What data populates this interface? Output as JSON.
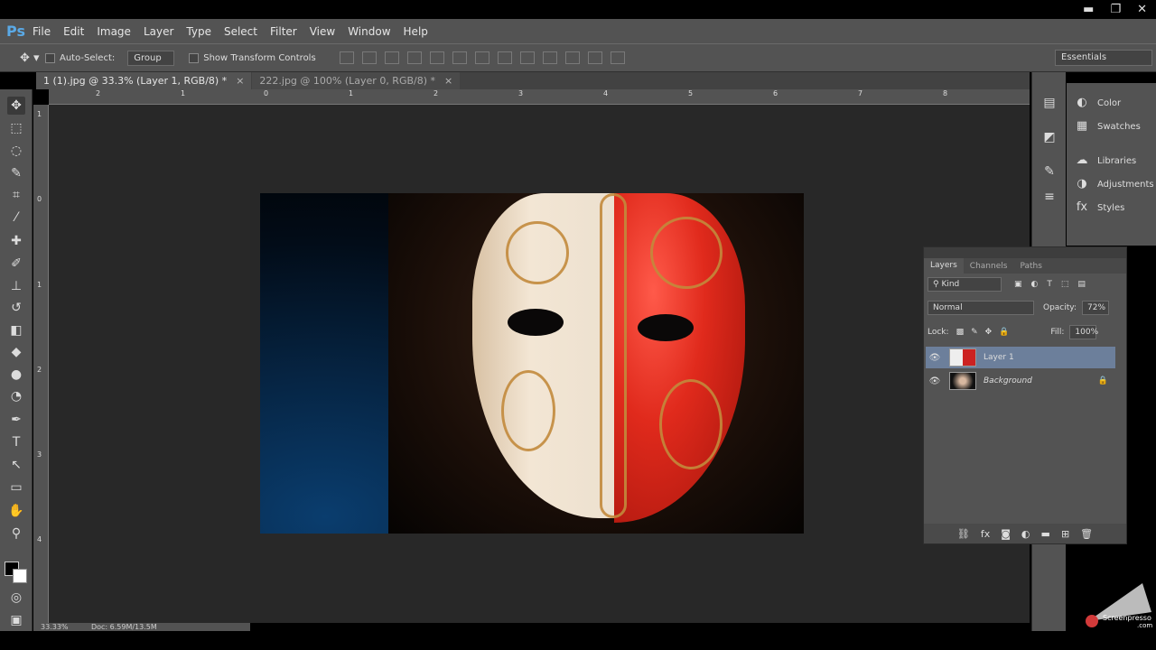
{
  "app": {
    "logo": "Ps"
  },
  "menu": [
    "File",
    "Edit",
    "Image",
    "Layer",
    "Type",
    "Select",
    "Filter",
    "View",
    "Window",
    "Help"
  ],
  "window_controls": {
    "minimize": "▬",
    "restore": "❐",
    "close": "✕"
  },
  "options": {
    "auto_select_label": "Auto-Select:",
    "auto_select_value": "Group",
    "transform_label": "Show Transform Controls",
    "workspace": "Essentials"
  },
  "tabs": [
    {
      "label": "1 (1).jpg @ 33.3% (Layer 1, RGB/8) *",
      "close": "×"
    },
    {
      "label": "222.jpg @ 100% (Layer 0, RGB/8) *",
      "close": "×"
    }
  ],
  "ruler_top": [
    "2",
    "1",
    "0",
    "1",
    "2",
    "3",
    "4",
    "5",
    "6",
    "7",
    "8"
  ],
  "ruler_left": [
    "1",
    "0",
    "1",
    "2",
    "3",
    "4"
  ],
  "status": {
    "zoom": "33.33%",
    "doc": "Doc: 6.59M/13.5M"
  },
  "panels": [
    {
      "icon": "color-icon",
      "glyph": "◐",
      "label": "Color"
    },
    {
      "icon": "swatches-icon",
      "glyph": "▦",
      "label": "Swatches"
    },
    {
      "icon": "libraries-icon",
      "glyph": "☁",
      "label": "Libraries"
    },
    {
      "icon": "adjustments-icon",
      "glyph": "◑",
      "label": "Adjustments"
    },
    {
      "icon": "styles-icon",
      "glyph": "fx",
      "label": "Styles"
    }
  ],
  "layers_panel": {
    "tabs": [
      "Layers",
      "Channels",
      "Paths"
    ],
    "filter": "Kind",
    "blend_mode": "Normal",
    "opacity_label": "Opacity:",
    "opacity_value": "72%",
    "lock_label": "Lock:",
    "fill_label": "Fill:",
    "fill_value": "100%",
    "layers": [
      {
        "name": "Layer 1",
        "selected": true
      },
      {
        "name": "Background",
        "selected": false,
        "locked": true
      }
    ]
  },
  "watermark": {
    "text": "Screenpresso",
    "sub": ".com"
  },
  "colors": {
    "accent": "#5aa9e6",
    "selected_layer": "#6c7f9b",
    "panel": "#535353"
  }
}
